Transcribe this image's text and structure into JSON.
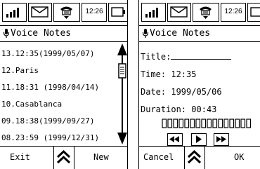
{
  "status_bar": {
    "time": "12:26",
    "icons": [
      "signal-icon",
      "mail-icon",
      "phone-icon",
      "battery-icon"
    ]
  },
  "app": {
    "title": "Voice Notes",
    "title_icon": "microphone-icon"
  },
  "left_screen": {
    "notes": [
      "13.12:35(1999/05/07)",
      "12.Paris",
      "11.18:31 (1998/04/14)",
      "10.Casablanca",
      "09.18:38(1999/09/27)",
      "08.23:59 (1999/12/31)"
    ],
    "scrollbar": {
      "thumb_position_fraction": 0.08
    },
    "bottom": {
      "left_label": "Exit",
      "right_label": "New",
      "center_icon": "double-chevron-up-icon"
    }
  },
  "right_screen": {
    "title_label": "Title:",
    "title_value": "",
    "time_label": "Time:",
    "time_value": "12:35",
    "date_label": "Date:",
    "date_value": "1999/05/06",
    "duration_label": "Duration:",
    "duration_value": "00:43",
    "level_meter": {
      "segments": 16,
      "filled": 0
    },
    "transport": [
      "rewind-icon",
      "play-icon",
      "fast-forward-icon"
    ],
    "bottom": {
      "left_label": "Cancel",
      "right_label": "OK",
      "center_icon": "double-chevron-up-icon"
    }
  }
}
